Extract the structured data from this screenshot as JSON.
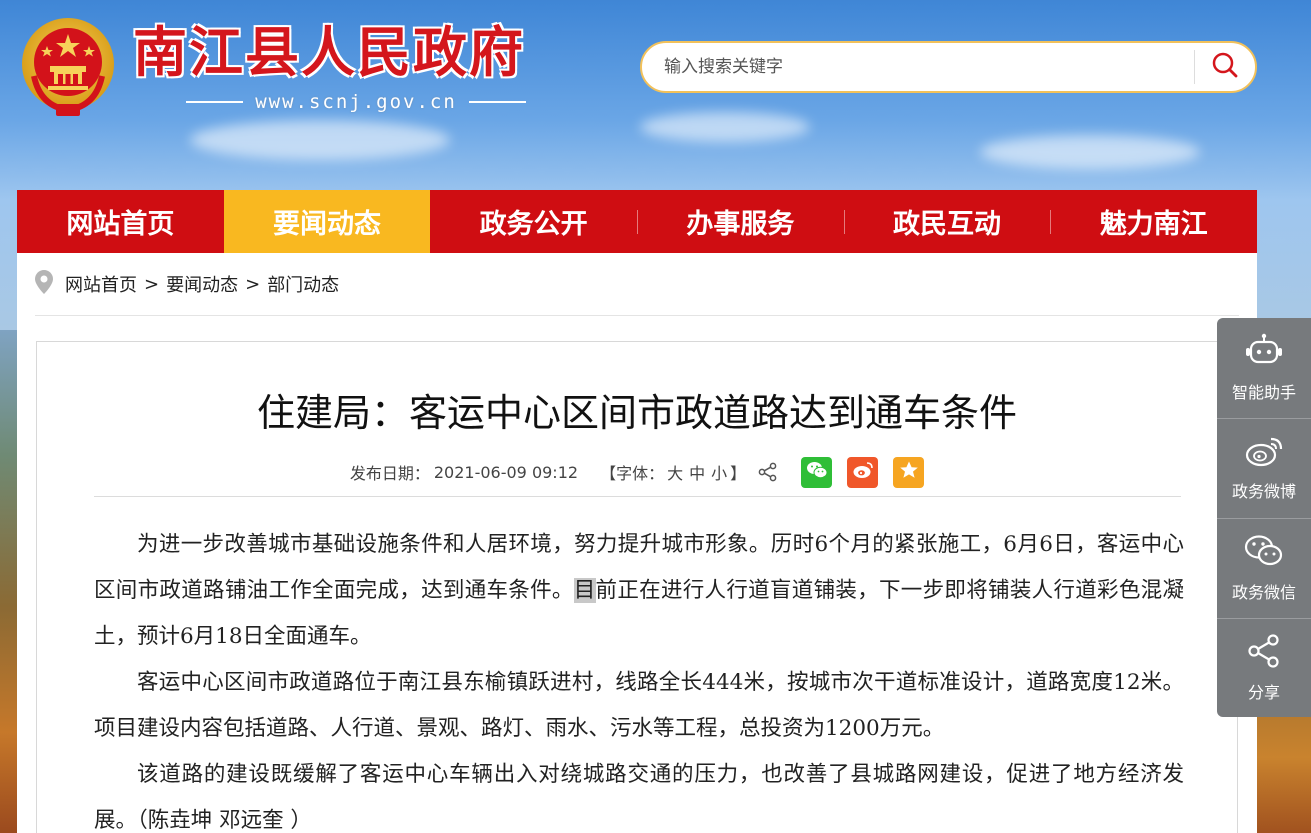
{
  "site": {
    "title": "南江县人民政府",
    "url": "www.scnj.gov.cn"
  },
  "search": {
    "placeholder": "输入搜索关键字"
  },
  "nav": {
    "items": [
      {
        "label": "网站首页"
      },
      {
        "label": "要闻动态"
      },
      {
        "label": "政务公开"
      },
      {
        "label": "办事服务"
      },
      {
        "label": "政民互动"
      },
      {
        "label": "魅力南江"
      }
    ],
    "active_index": 1
  },
  "breadcrumb": {
    "items": [
      "网站首页",
      "要闻动态",
      "部门动态"
    ],
    "separator": ">"
  },
  "article": {
    "title": "住建局：客运中心区间市政道路达到通车条件",
    "date_label": "发布日期：",
    "date_value": "2021-06-09 09:12",
    "font_label_open": "【字体：",
    "font_large": "大",
    "font_medium": "中",
    "font_small": "小",
    "font_label_close": "】",
    "p1_before": "为进一步改善城市基础设施条件和人居环境，努力提升城市形象。历时6个月的紧张施工，6月6日，客运中心区间市政道路铺油工作全面完成，达到通车条件。",
    "p1_highlight": "目",
    "p1_after": "前正在进行人行道盲道铺装，下一步即将铺装人行道彩色混凝土，预计6月18日全面通车。",
    "p2": "客运中心区间市政道路位于南江县东榆镇跃进村，线路全长444米，按城市次干道标准设计，道路宽度12米。项目建设内容包括道路、人行道、景观、路灯、雨水、污水等工程，总投资为1200万元。",
    "p3": "该道路的建设既缓解了客运中心车辆出入对绕城路交通的压力，也改善了县城路网建设，促进了地方经济发展。（陈垚坤 邓远奎 ）"
  },
  "side_tools": {
    "assistant": "智能助手",
    "weibo": "政务微博",
    "wechat": "政务微信",
    "share": "分享"
  },
  "colors": {
    "nav_red": "#cf0d12",
    "nav_active": "#f9b820",
    "title_red": "#d4161c",
    "wechat_green": "#2fbe37",
    "weibo_orange": "#f0572a",
    "favorite_yellow": "#f6a521"
  }
}
